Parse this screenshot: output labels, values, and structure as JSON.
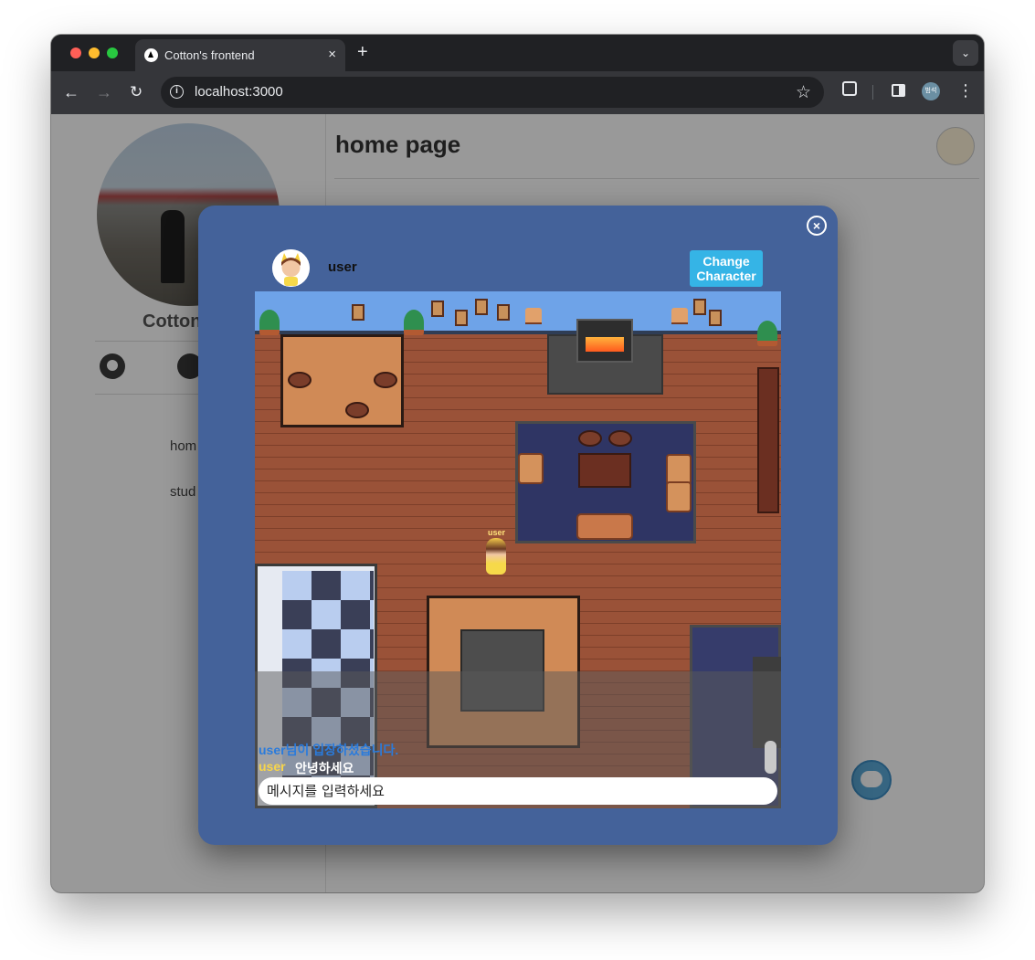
{
  "browser": {
    "tab_title": "Cotton's frontend",
    "tab_close": "×",
    "new_tab": "+",
    "url": "localhost:3000",
    "profile_initials": "범석"
  },
  "page": {
    "title": "home page",
    "profile_name": "Cotton",
    "nav": [
      {
        "label": "hom"
      },
      {
        "label": "stud"
      }
    ]
  },
  "modal": {
    "username": "user",
    "change_character_label": "Change Character",
    "close_icon": "×"
  },
  "game": {
    "character_label": "user",
    "chat": {
      "system_message": "user님이 입장하셨습니다.",
      "messages": [
        {
          "user": "user",
          "text": "안녕하세요"
        }
      ],
      "input_placeholder": "메시지를 입력하세요"
    }
  }
}
